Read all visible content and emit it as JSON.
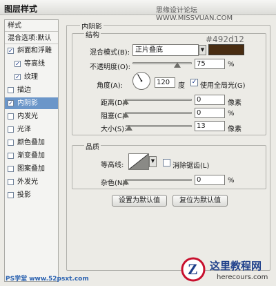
{
  "window": {
    "title": "图层样式",
    "watermark_top": "思缘设计论坛 WWW.MISSVUAN.COM"
  },
  "sidebar": {
    "header": "样式",
    "blend_options": "混合选项:默认",
    "items": [
      {
        "label": "斜面和浮雕",
        "checked": true
      },
      {
        "label": "等高线",
        "checked": true
      },
      {
        "label": "纹理",
        "checked": true
      },
      {
        "label": "描边",
        "checked": false
      },
      {
        "label": "内阴影",
        "checked": true
      },
      {
        "label": "内发光",
        "checked": false
      },
      {
        "label": "光泽",
        "checked": false
      },
      {
        "label": "颜色叠加",
        "checked": false
      },
      {
        "label": "渐变叠加",
        "checked": false
      },
      {
        "label": "图案叠加",
        "checked": false
      },
      {
        "label": "外发光",
        "checked": false
      },
      {
        "label": "投影",
        "checked": false
      }
    ],
    "check_mark": "✓"
  },
  "inner_shadow": {
    "section_title": "内阴影",
    "structure_title": "结构",
    "blend_mode_label": "混合模式(B):",
    "blend_mode_value": "正片叠底",
    "color_hex_label": "#492d12",
    "color": "#492d12",
    "opacity_label": "不透明度(O):",
    "opacity_value": "75",
    "opacity_percent": 75,
    "percent_unit": "%",
    "angle_label": "角度(A):",
    "angle_value": "120",
    "angle_deg": 120,
    "degree_unit": "度",
    "global_light_label": "使用全局光(G)",
    "global_light_checked": true,
    "distance_label": "距离(D):",
    "distance_value": "0",
    "distance_fraction": 0,
    "choke_label": "阻塞(C):",
    "choke_value": "0",
    "choke_fraction": 0,
    "size_label": "大小(S):",
    "size_value": "13",
    "size_fraction": 0.05,
    "pixel_unit": "像素"
  },
  "quality": {
    "title": "品质",
    "contour_label": "等高线:",
    "anti_alias_label": "消除锯齿(L)",
    "anti_alias_checked": false,
    "noise_label": "杂色(N):",
    "noise_value": "0",
    "noise_fraction": 0,
    "percent_unit": "%"
  },
  "buttons": {
    "make_default": "设置为默认值",
    "reset_default": "复位为默认值"
  },
  "watermarks": {
    "bottom_left": "PS学堂 www.52psxt.com",
    "logo_letter": "Z",
    "brand_cn": "这里教程网",
    "brand_url": "herecours.com"
  }
}
